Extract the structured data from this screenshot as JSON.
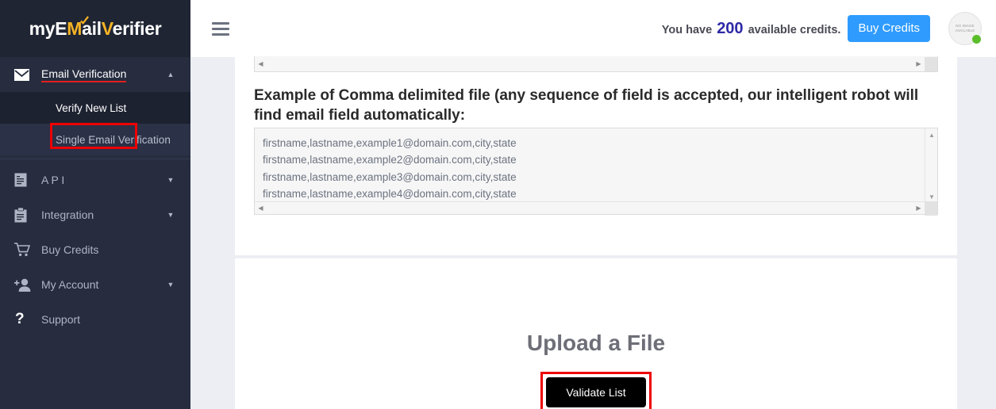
{
  "brand": {
    "logo_part1": "myE",
    "logo_accent1": "M",
    "logo_part2": "ail",
    "logo_accent2": "V",
    "logo_part3": "erifier",
    "logo_full": "myEMailVerifier"
  },
  "colors": {
    "sidebar_bg": "#272d3f",
    "sidebar_logo_bg": "#1f2533",
    "accent_yellow": "#f5b324",
    "primary_blue": "#2f9bff",
    "credits_number": "#2e2aa6",
    "annotation_red": "#ee0000",
    "status_green": "#5bbd2a",
    "page_bg": "#eceef3",
    "button_black": "#000000"
  },
  "sidebar": {
    "items": [
      {
        "label": "Email Verification",
        "icon": "envelope-icon",
        "chevron": "chevron-up",
        "active": true
      },
      {
        "label": "A P I",
        "icon": "document-icon",
        "chevron": "chevron-down",
        "active": false
      },
      {
        "label": "Integration",
        "icon": "clipboard-icon",
        "chevron": "chevron-down",
        "active": false
      },
      {
        "label": "Buy Credits",
        "icon": "cart-icon",
        "chevron": "",
        "active": false
      },
      {
        "label": "My Account",
        "icon": "person-add-icon",
        "chevron": "chevron-down",
        "active": false
      },
      {
        "label": "Support",
        "icon": "question-mark-icon",
        "chevron": "",
        "active": false
      }
    ],
    "subitems": [
      {
        "label": "Verify New List",
        "highlighted": true
      },
      {
        "label": "Single Email Verification",
        "highlighted": false
      }
    ]
  },
  "header": {
    "menu_icon": "hamburger-icon",
    "credits_prefix": "You have",
    "credits_count": "200",
    "credits_suffix": "available credits.",
    "buy_credits_label": "Buy Credits",
    "avatar": {
      "line1": "NO IMAGE",
      "line2": "AVAILABLE",
      "status": "online"
    }
  },
  "main": {
    "section_heading": "Example of Comma delimited file (any sequence of field is accepted, our intelligent robot will find email field automatically:",
    "example_lines": [
      "firstname,lastname,example1@domain.com,city,state",
      "firstname,lastname,example2@domain.com,city,state",
      "firstname,lastname,example3@domain.com,city,state",
      "firstname,lastname,example4@domain.com,city,state"
    ],
    "upload_title": "Upload a File",
    "validate_button_label": "Validate List"
  }
}
